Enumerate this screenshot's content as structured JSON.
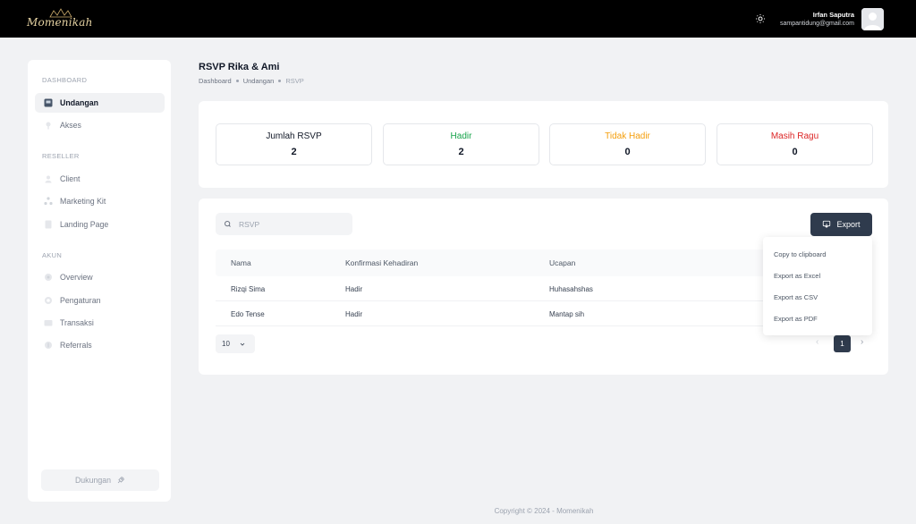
{
  "header": {
    "logo_text": "Momenikah",
    "user_name": "Irfan Saputra",
    "user_email": "sampantidung@gmail.com"
  },
  "sidebar": {
    "sections": [
      {
        "label": "DASHBOARD"
      },
      {
        "label": "RESELLER"
      },
      {
        "label": "AKUN"
      }
    ],
    "items": [
      {
        "label": "Undangan",
        "icon": "invitation-icon",
        "active": true
      },
      {
        "label": "Akses",
        "icon": "key-icon"
      },
      {
        "label": "Client",
        "icon": "user-icon"
      },
      {
        "label": "Marketing Kit",
        "icon": "share-icon"
      },
      {
        "label": "Landing Page",
        "icon": "page-icon"
      },
      {
        "label": "Overview",
        "icon": "overview-icon"
      },
      {
        "label": "Pengaturan",
        "icon": "settings-icon"
      },
      {
        "label": "Transaksi",
        "icon": "wallet-icon"
      },
      {
        "label": "Referrals",
        "icon": "dollar-icon"
      }
    ],
    "support_label": "Dukungan"
  },
  "page": {
    "title": "RSVP Rika & Ami",
    "breadcrumb": [
      "Dashboard",
      "Undangan",
      "RSVP"
    ]
  },
  "stats": [
    {
      "title": "Jumlah RSVP",
      "value": "2",
      "color": "#111827"
    },
    {
      "title": "Hadir",
      "value": "2",
      "color": "#16a34a"
    },
    {
      "title": "Tidak Hadir",
      "value": "0",
      "color": "#f59e0b"
    },
    {
      "title": "Masih Ragu",
      "value": "0",
      "color": "#dc2626"
    }
  ],
  "table": {
    "search_placeholder": "RSVP",
    "export_label": "Export",
    "columns": [
      "Nama",
      "Konfirmasi Kehadiran",
      "Ucapan"
    ],
    "rows": [
      [
        "Rizqi Sima",
        "Hadir",
        "Huhasahshas"
      ],
      [
        "Edo Tense",
        "Hadir",
        "Mantap sih"
      ]
    ],
    "page_size": "10",
    "current_page": "1"
  },
  "export_menu": [
    "Copy to clipboard",
    "Export as Excel",
    "Export as CSV",
    "Export as PDF"
  ],
  "footer": "Copyright © 2024 - Momenikah",
  "colors": {
    "primary": "#2f3b4d",
    "topbar": "#000000",
    "logo_gold": "#e6d3a3"
  }
}
